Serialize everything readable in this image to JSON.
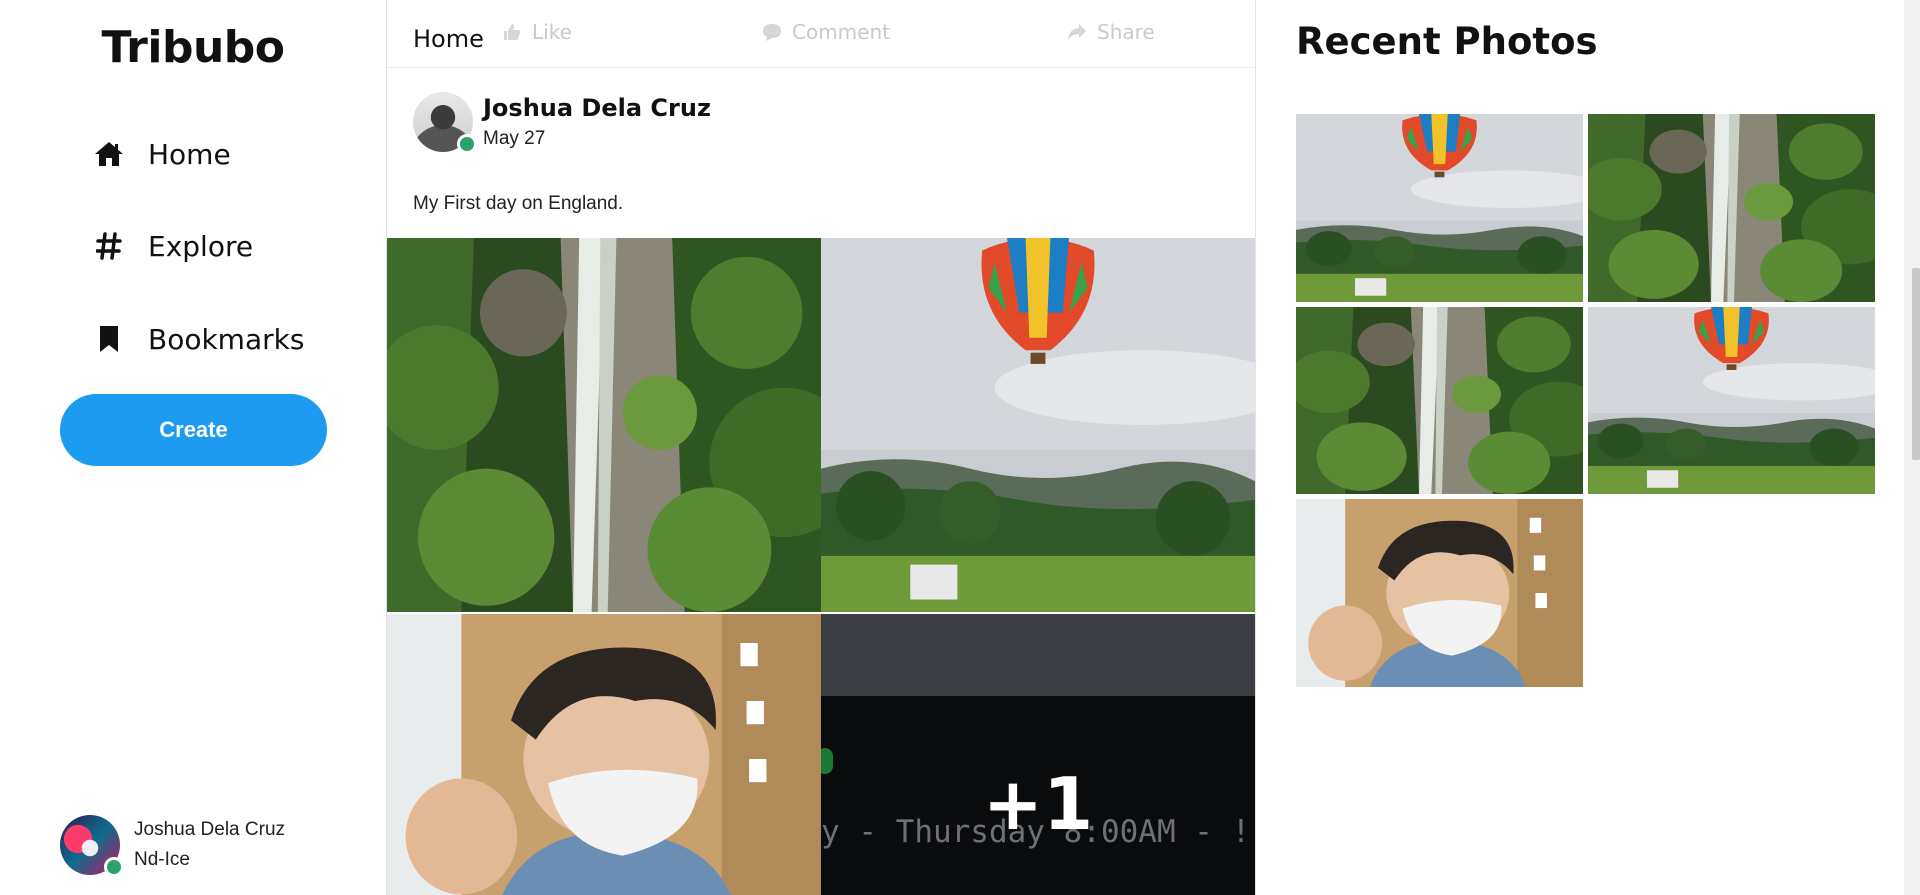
{
  "brand": "Tribubo",
  "nav": {
    "home": "Home",
    "explore": "Explore",
    "bookmarks": "Bookmarks",
    "create": "Create"
  },
  "current_user": {
    "name": "Joshua Dela Cruz",
    "handle": "Nd-Ice",
    "status": "online"
  },
  "feed": {
    "header": "Home",
    "actions": {
      "like": "Like",
      "comment": "Comment",
      "share": "Share"
    },
    "post": {
      "author": "Joshua Dela Cruz",
      "date": "May 27",
      "text": "My First day on England.",
      "more_count": "+1",
      "overlay_text": "y - Thursday 8:00AM - !"
    }
  },
  "recent_photos": {
    "title": "Recent Photos",
    "items": [
      "balloon",
      "waterfall",
      "waterfall",
      "balloon",
      "person"
    ]
  },
  "colors": {
    "accent": "#1d9bf0",
    "online": "#2aa36b"
  }
}
